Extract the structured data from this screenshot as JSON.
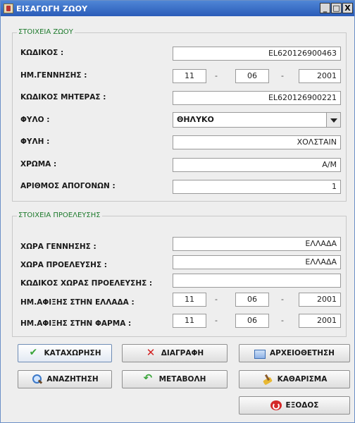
{
  "window": {
    "title": "ΕΙΣΑΓΩΓΗ ΖΩΟΥ",
    "controls": [
      "_",
      "□",
      "X"
    ]
  },
  "animal": {
    "legend": "ΣΤΟΙΧΕΙΑ ΖΩΟΥ",
    "code_label": "ΚΩΔΙΚΟΣ :",
    "code_value": "EL620126900463",
    "birth_label": "ΗΜ.ΓΕΝΝΗΣΗΣ :",
    "birth_day": "11",
    "birth_month": "06",
    "birth_year": "2001",
    "mother_label": "ΚΩΔΙΚΟΣ ΜΗΤΕΡΑΣ :",
    "mother_value": "EL620126900221",
    "sex_label": "ΦΥΛΟ :",
    "sex_value": "ΘΗΛΥΚΟ",
    "breed_label": "ΦΥΛΗ :",
    "breed_value": "ΧΟΛΣΤΑΙΝ",
    "color_label": "ΧΡΩΜΑ :",
    "color_value": "Α/Μ",
    "offspring_label": "ΑΡΙΘΜΟΣ ΑΠΟΓΟΝΩΝ :",
    "offspring_value": "1"
  },
  "origin": {
    "legend": "ΣΤΟΙΧΕΙΑ ΠΡΟΕΛΕΥΣΗΣ",
    "birth_country_label": "ΧΩΡΑ ΓΕΝΝΗΣΗΣ :",
    "birth_country_value": "ΕΛΛΑΔΑ",
    "origin_country_label": "ΧΩΡΑ ΠΡΟΕΛΕΥΣΗΣ :",
    "origin_country_value": "ΕΛΛΑΔΑ",
    "origin_code_label": "ΚΩΔΙΚΟΣ ΧΩΡΑΣ ΠΡΟΕΛΕΥΣΗΣ :",
    "origin_code_value": "",
    "arrival_greece_label": "ΗΜ.ΑΦΙΞΗΣ ΣΤΗΝ ΕΛΛΑΔΑ :",
    "ag_day": "11",
    "ag_month": "06",
    "ag_year": "2001",
    "arrival_farm_label": "ΗΜ.ΑΦΙΞΗΣ ΣΤΗΝ ΦΑΡΜΑ :",
    "af_day": "11",
    "af_month": "06",
    "af_year": "2001"
  },
  "date_separator": "-",
  "buttons": {
    "save": "ΚΑΤΑΧΩΡΗΣΗ",
    "delete": "ΔΙΑΓΡΑΦΗ",
    "archive": "ΑΡΧΕΙΟΘΕΤΗΣΗ",
    "search": "ΑΝΑΖΗΤΗΣΗ",
    "edit": "ΜΕΤΑΒΟΛΗ",
    "clear": "ΚΑΘΑΡΙΣΜΑ",
    "exit": "ΕΞΟΔΟΣ"
  }
}
